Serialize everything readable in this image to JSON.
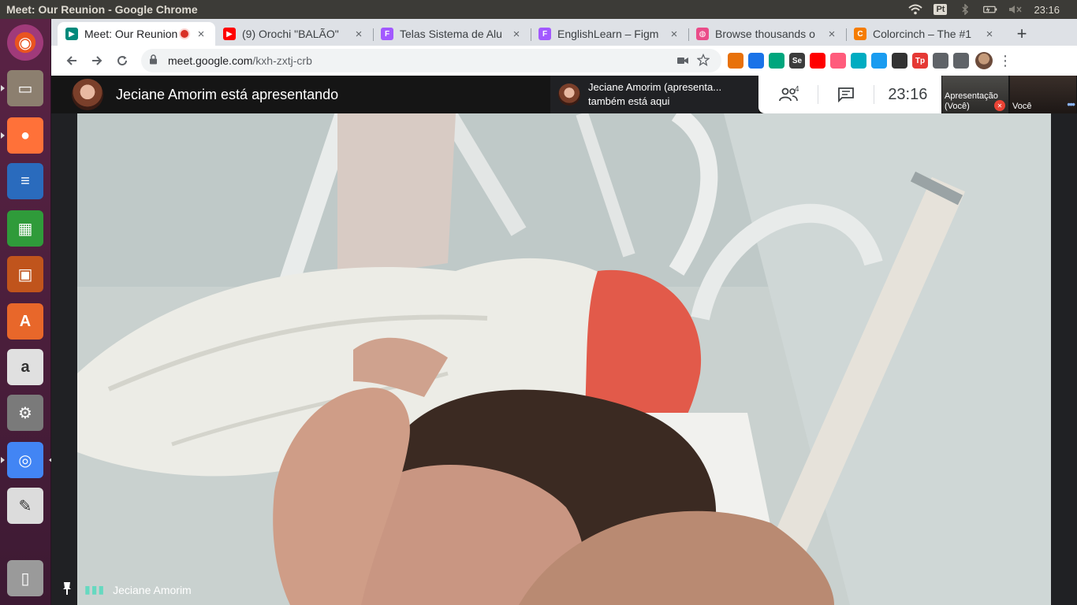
{
  "system": {
    "window_title": "Meet: Our Reunion - Google Chrome",
    "keyboard_layout": "Pt",
    "clock": "23:16",
    "icons": [
      "wifi-icon",
      "keyboard-layout-icon",
      "bluetooth-icon",
      "battery-icon",
      "volume-muted-icon"
    ]
  },
  "launcher": {
    "items": [
      {
        "name": "ubuntu-dash",
        "icon": "ubuntu-logo-icon",
        "color": "#e95420"
      },
      {
        "name": "files",
        "icon": "file-cabinet-icon",
        "color": "#8c7f6f"
      },
      {
        "name": "firefox",
        "icon": "firefox-icon",
        "color": "#ff7139"
      },
      {
        "name": "libreoffice-writer",
        "icon": "writer-icon",
        "color": "#2a6bbd"
      },
      {
        "name": "libreoffice-calc",
        "icon": "calc-icon",
        "color": "#2f9b3a"
      },
      {
        "name": "libreoffice-impress",
        "icon": "impress-icon",
        "color": "#c0541c"
      },
      {
        "name": "software-center",
        "icon": "shopping-bag-icon",
        "color": "#e8672a"
      },
      {
        "name": "amazon",
        "icon": "amazon-icon",
        "color": "#e0e0e0"
      },
      {
        "name": "system-settings",
        "icon": "settings-wrench-icon",
        "color": "#7a7a7a"
      },
      {
        "name": "google-chrome",
        "icon": "chrome-icon",
        "color": "#4285f4"
      },
      {
        "name": "text-editor",
        "icon": "text-editor-icon",
        "color": "#dcdcdc"
      },
      {
        "name": "trash",
        "icon": "trash-icon",
        "color": "#9a9a9a"
      }
    ]
  },
  "browser": {
    "tabs": [
      {
        "label": "Meet: Our Reunion",
        "icon": "google-meet-icon",
        "color": "#00897b",
        "active": true,
        "recording": true
      },
      {
        "label": "(9) Orochi \"BALÃO\"",
        "icon": "youtube-icon",
        "color": "#ff0000",
        "active": false
      },
      {
        "label": "Telas Sistema de Alu",
        "icon": "figma-icon",
        "color": "#a259ff",
        "active": false
      },
      {
        "label": "EnglishLearn – Figm",
        "icon": "figma-icon",
        "color": "#a259ff",
        "active": false
      },
      {
        "label": "Browse thousands o",
        "icon": "dribbble-icon",
        "color": "#ea4c89",
        "active": false
      },
      {
        "label": "Colorcinch – The #1",
        "icon": "colorcinch-icon",
        "color": "#f57c00",
        "active": false
      }
    ],
    "close_glyph": "×",
    "new_tab_glyph": "+",
    "url_domain": "meet.google.com",
    "url_path": "/kxh-zxtj-crb",
    "extensions": [
      {
        "icon": "extension-orange-circle-icon",
        "color": "#e8710a",
        "text": ""
      },
      {
        "icon": "eyedropper-icon",
        "color": "#1a73e8",
        "text": ""
      },
      {
        "icon": "hummingbird-icon",
        "color": "#00a67d",
        "text": ""
      },
      {
        "icon": "selenium-icon",
        "color": "#3c3c3c",
        "text": "Se"
      },
      {
        "icon": "video-red-icon",
        "color": "#ff0000",
        "text": ""
      },
      {
        "icon": "flow-icon",
        "color": "#ff5c7c",
        "text": ""
      },
      {
        "icon": "screen-cast-icon",
        "color": "#00acc1",
        "text": ""
      },
      {
        "icon": "download-arrow-icon",
        "color": "#1a9cf0",
        "text": ""
      },
      {
        "icon": "color-dots-icon",
        "color": "#333333",
        "text": ""
      },
      {
        "icon": "tp-icon",
        "color": "#e53935",
        "text": "Tp"
      },
      {
        "icon": "picture-in-picture-icon",
        "color": "#5f6368",
        "text": ""
      },
      {
        "icon": "puzzle-extensions-icon",
        "color": "#5f6368",
        "text": ""
      }
    ]
  },
  "meet": {
    "presenter_banner": "Jeciane Amorim está apresentando",
    "notice_line1": "Jeciane Amorim (apresenta...",
    "notice_line2": "também está aqui",
    "participants_count": "4",
    "clock": "23:16",
    "self_tile_presentation_label_1": "Apresentação",
    "self_tile_presentation_label_2": "(Você)",
    "self_tile_camera_label": "Você",
    "speaker_name": "Jeciane Amorim",
    "speaking_glyph": "▮▮▮"
  }
}
